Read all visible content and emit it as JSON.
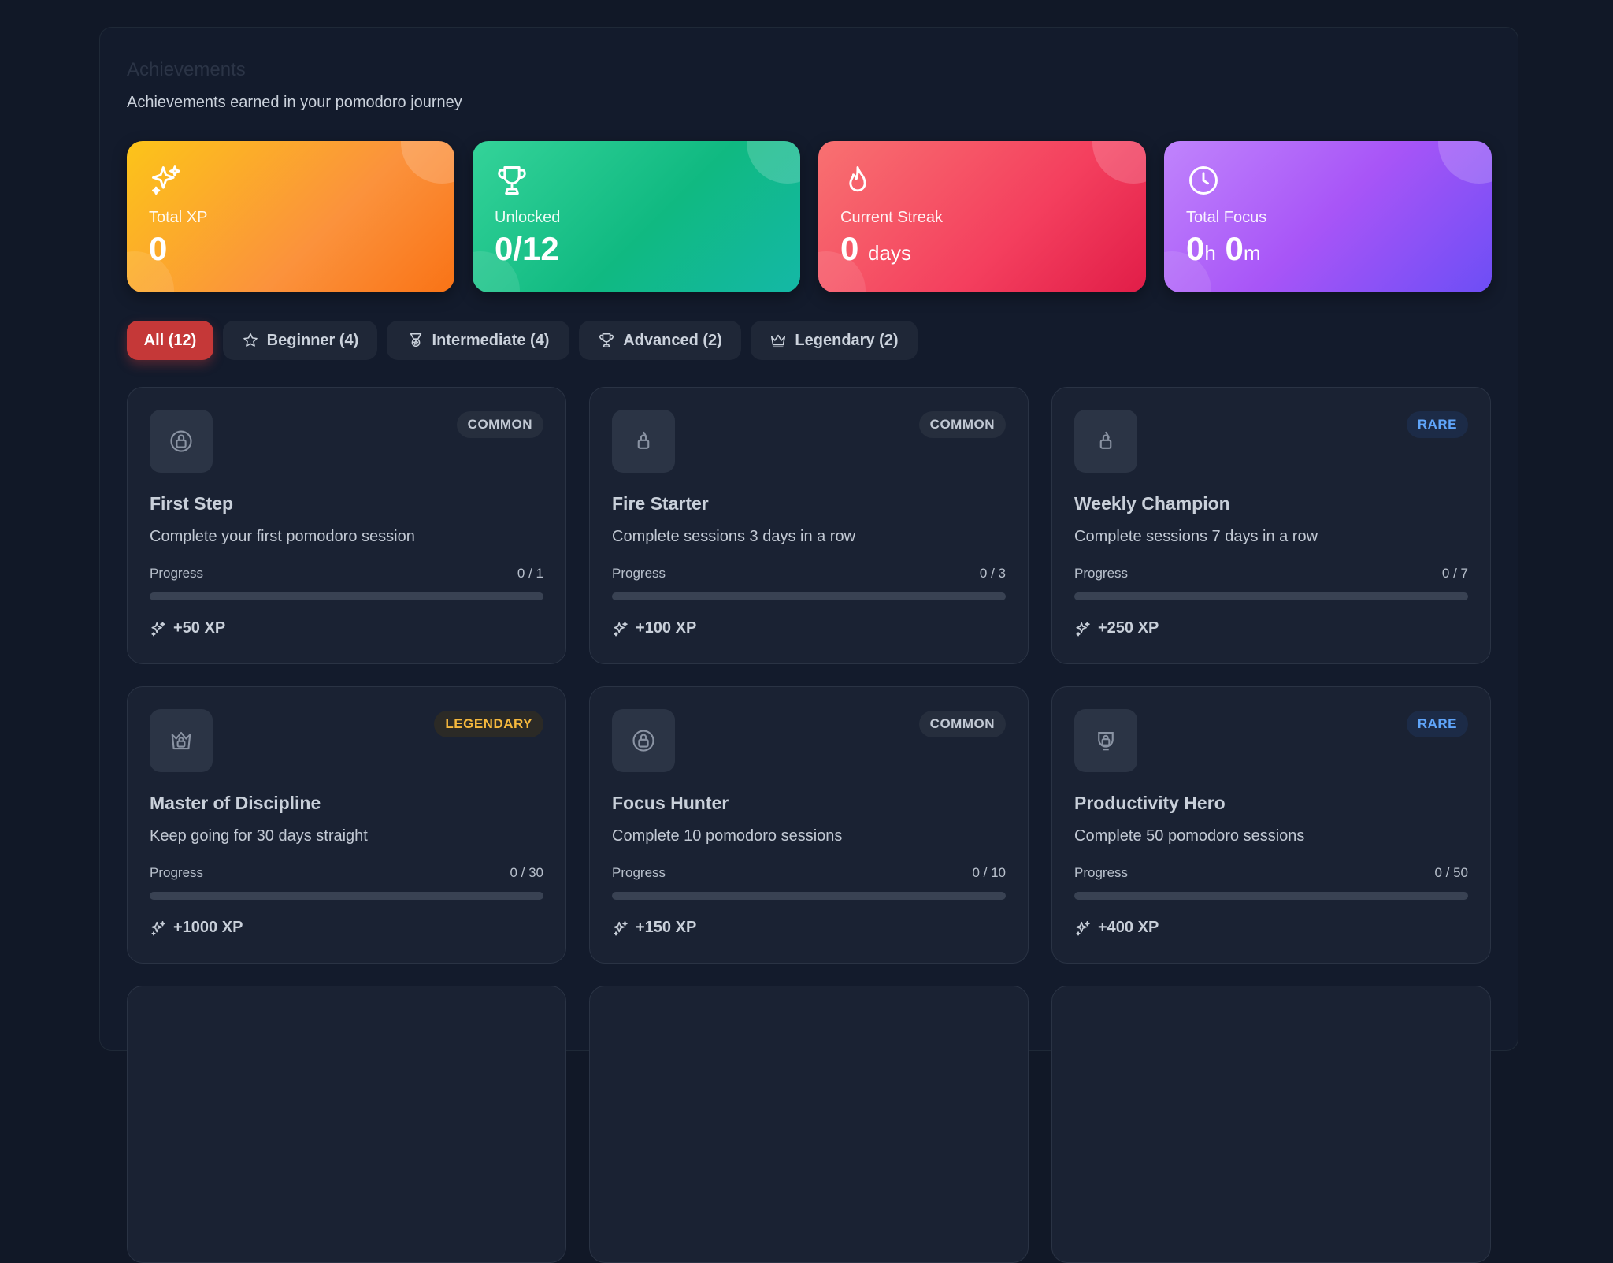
{
  "header": {
    "title": "Achievements",
    "subtitle": "Achievements earned in your pomodoro journey"
  },
  "stats": {
    "total_xp": {
      "label": "Total XP",
      "value": "0",
      "icon": "sparkles-icon"
    },
    "unlocked": {
      "label": "Unlocked",
      "value": "0/12",
      "icon": "trophy-icon"
    },
    "streak": {
      "label": "Current Streak",
      "value": "0",
      "unit": "days",
      "icon": "flame-icon"
    },
    "focus": {
      "label": "Total Focus",
      "hours": "0",
      "hours_unit": "h",
      "minutes": "0",
      "minutes_unit": "m",
      "icon": "clock-icon"
    }
  },
  "filters": [
    {
      "label": "All (12)",
      "active": true
    },
    {
      "label": "Beginner (4)",
      "icon": "star-icon"
    },
    {
      "label": "Intermediate (4)",
      "icon": "medal-icon"
    },
    {
      "label": "Advanced (2)",
      "icon": "trophy-icon"
    },
    {
      "label": "Legendary (2)",
      "icon": "crown-icon"
    }
  ],
  "progress_label": "Progress",
  "achievements": [
    {
      "name": "First Step",
      "description": "Complete your first pomodoro session",
      "rarity": "COMMON",
      "progress": "0 / 1",
      "fraction": 0,
      "xp": "+50 XP",
      "icon": "lock-icon"
    },
    {
      "name": "Fire Starter",
      "description": "Complete sessions 3 days in a row",
      "rarity": "COMMON",
      "progress": "0 / 3",
      "fraction": 0,
      "xp": "+100 XP",
      "icon": "lock-icon"
    },
    {
      "name": "Weekly Champion",
      "description": "Complete sessions 7 days in a row",
      "rarity": "RARE",
      "progress": "0 / 7",
      "fraction": 0,
      "xp": "+250 XP",
      "icon": "lock-icon"
    },
    {
      "name": "Master of Discipline",
      "description": "Keep going for 30 days straight",
      "rarity": "LEGENDARY",
      "progress": "0 / 30",
      "fraction": 0,
      "xp": "+1000 XP",
      "icon": "lock-icon"
    },
    {
      "name": "Focus Hunter",
      "description": "Complete 10 pomodoro sessions",
      "rarity": "COMMON",
      "progress": "0 / 10",
      "fraction": 0,
      "xp": "+150 XP",
      "icon": "lock-icon"
    },
    {
      "name": "Productivity Hero",
      "description": "Complete 50 pomodoro sessions",
      "rarity": "RARE",
      "progress": "0 / 50",
      "fraction": 0,
      "xp": "+400 XP",
      "icon": "lock-icon"
    }
  ],
  "colors": {
    "accent_active_filter": "#c53838",
    "rare": "#60a5fa",
    "legendary": "#f5b83d"
  }
}
